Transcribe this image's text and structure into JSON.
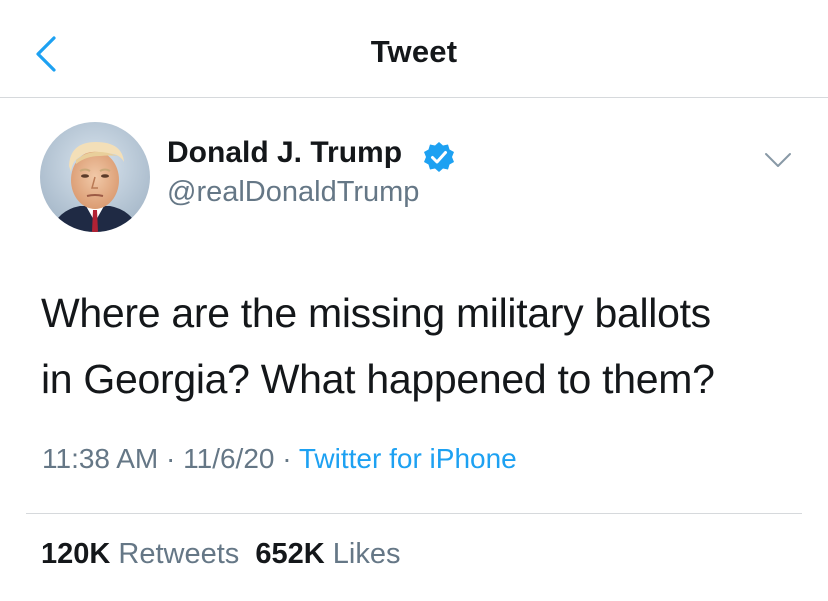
{
  "header": {
    "title": "Tweet",
    "back_icon": "chevron-left-icon",
    "accent_color": "#1da1f2"
  },
  "author": {
    "display_name": "Donald J. Trump",
    "handle": "@realDonaldTrump",
    "verified": true,
    "verified_icon": "verified-badge-icon"
  },
  "tweet": {
    "text_line1": "Where are the missing military ballots",
    "text_line2": "in Georgia? What happened to them?",
    "time": "11:38 AM",
    "separator": "·",
    "date": "11/6/20",
    "source": "Twitter for iPhone",
    "more_icon": "chevron-down-icon"
  },
  "stats": {
    "retweets_count": "120K",
    "retweets_label": "Retweets",
    "likes_count": "652K",
    "likes_label": "Likes"
  },
  "colors": {
    "text": "#14171a",
    "secondary": "#657786",
    "link": "#1da1f2",
    "divider": "#d6d9dc"
  }
}
